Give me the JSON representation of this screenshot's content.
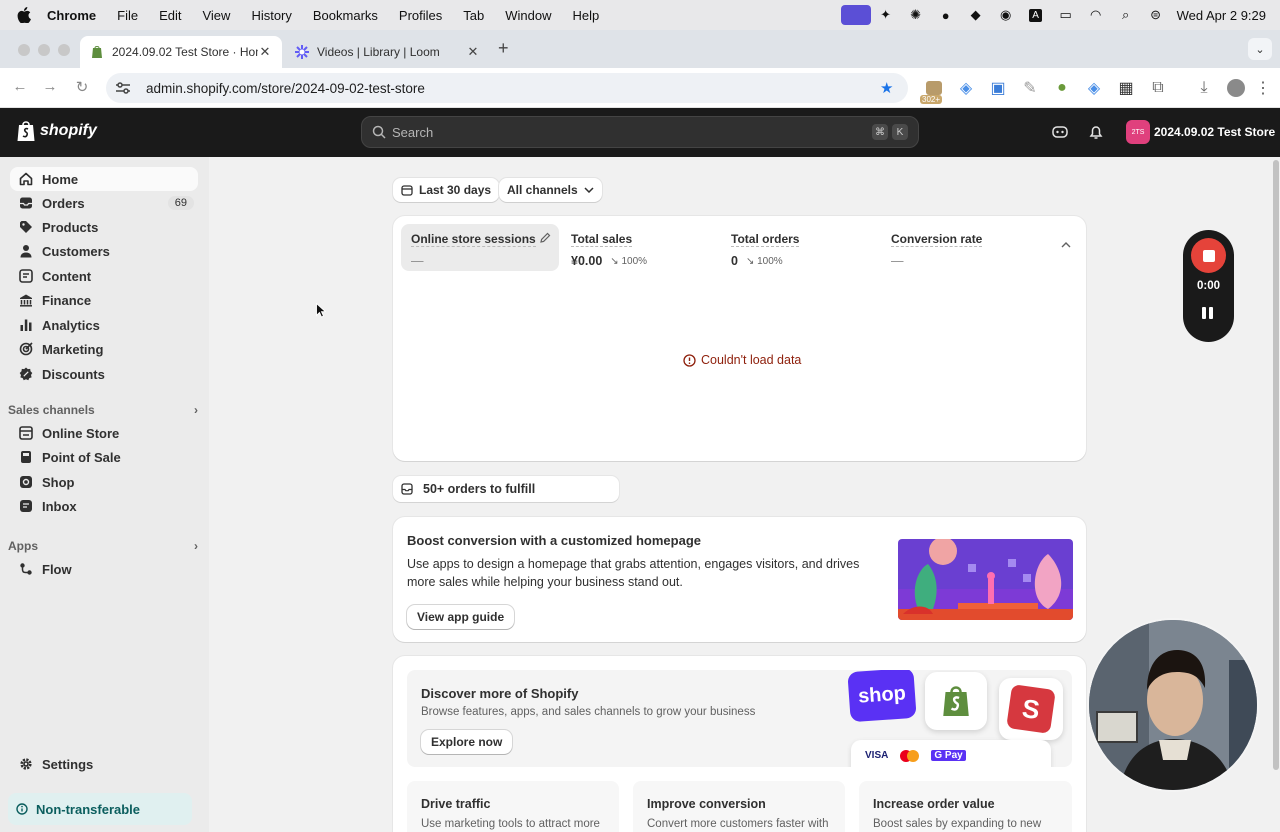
{
  "menubar": {
    "app": "Chrome",
    "items": [
      "File",
      "Edit",
      "View",
      "History",
      "Bookmarks",
      "Profiles",
      "Tab",
      "Window",
      "Help"
    ],
    "clock": "Wed Apr 2  9:29"
  },
  "tabs": [
    {
      "title": "2024.09.02 Test Store · Home"
    },
    {
      "title": "Videos | Library | Loom"
    }
  ],
  "address": {
    "url": "admin.shopify.com/store/2024-09-02-test-store",
    "ext_badge": "302+"
  },
  "topnav": {
    "brand": "shopify",
    "search_placeholder": "Search",
    "kbd1": "⌘",
    "kbd2": "K",
    "store_initials": "2TS",
    "store_name": "2024.09.02 Test Store"
  },
  "sidebar": {
    "items": [
      {
        "label": "Home"
      },
      {
        "label": "Orders",
        "count": "69"
      },
      {
        "label": "Products"
      },
      {
        "label": "Customers"
      },
      {
        "label": "Content"
      },
      {
        "label": "Finance"
      },
      {
        "label": "Analytics"
      },
      {
        "label": "Marketing"
      },
      {
        "label": "Discounts"
      }
    ],
    "sales_channels_title": "Sales channels",
    "sales_channels": [
      {
        "label": "Online Store"
      },
      {
        "label": "Point of Sale"
      },
      {
        "label": "Shop"
      },
      {
        "label": "Inbox"
      }
    ],
    "apps_title": "Apps",
    "apps": [
      {
        "label": "Flow"
      }
    ],
    "settings": "Settings",
    "non_transferable": "Non-transferable"
  },
  "filters": {
    "date_range": "Last 30 days",
    "channels": "All channels"
  },
  "metrics": [
    {
      "title": "Online store sessions",
      "value": "—",
      "change": ""
    },
    {
      "title": "Total sales",
      "value": "¥0.00",
      "change": "100%"
    },
    {
      "title": "Total orders",
      "value": "0",
      "change": "100%"
    },
    {
      "title": "Conversion rate",
      "value": "—",
      "change": ""
    }
  ],
  "error_text": "Couldn't load data",
  "fulfill": "50+ orders to fulfill",
  "boost": {
    "title": "Boost conversion with a customized homepage",
    "body": "Use apps to design a homepage that grabs attention, engages visitors, and drives more sales while helping your business stand out.",
    "button": "View app guide"
  },
  "discover": {
    "title": "Discover more of Shopify",
    "body": "Browse features, apps, and sales channels to grow your business",
    "button": "Explore now",
    "shop_logo": "shop",
    "card_brands": [
      "VISA",
      "G Pay"
    ]
  },
  "tiles": [
    {
      "title": "Drive traffic",
      "body": "Use marketing tools to attract more"
    },
    {
      "title": "Improve conversion",
      "body": "Convert more customers faster with"
    },
    {
      "title": "Increase order value",
      "body": "Boost sales by expanding to new"
    }
  ],
  "recorder": {
    "time": "0:00"
  },
  "colors": {
    "brand_dark": "#1a1a1a",
    "error": "#8e1f0b",
    "record": "#e5433a",
    "store_avatar": "#e0407d"
  }
}
